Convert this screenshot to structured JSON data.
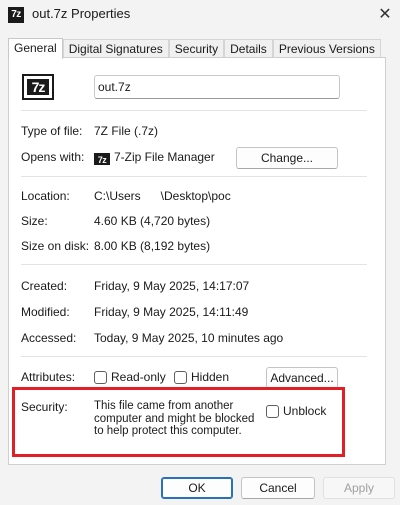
{
  "window": {
    "title": "out.7z Properties",
    "close_glyph": "✕",
    "icon_text": "7z"
  },
  "tabs": [
    {
      "label": "General"
    },
    {
      "label": "Digital Signatures"
    },
    {
      "label": "Security"
    },
    {
      "label": "Details"
    },
    {
      "label": "Previous Versions"
    }
  ],
  "general": {
    "icon_text": "7z",
    "file_name": "out.7z",
    "type_label": "Type of file:",
    "type_value": "7Z File (.7z)",
    "opens_label": "Opens with:",
    "opens_icon_text": "7z",
    "opens_value": "7-Zip File Manager",
    "change_button": "Change...",
    "location_label": "Location:",
    "location_value": "C:\\Users      \\Desktop\\poc",
    "size_label": "Size:",
    "size_value": "4.60 KB (4,720 bytes)",
    "size_disk_label": "Size on disk:",
    "size_disk_value": "8.00 KB (8,192 bytes)",
    "created_label": "Created:",
    "created_value": "Friday, 9 May 2025, 14:17:07",
    "modified_label": "Modified:",
    "modified_value": "Friday, 9 May 2025, 14:11:49",
    "accessed_label": "Accessed:",
    "accessed_value": "Today, 9 May 2025, 10 minutes ago",
    "attributes_label": "Attributes:",
    "readonly_label": "Read-only",
    "hidden_label": "Hidden",
    "advanced_button": "Advanced...",
    "security_label": "Security:",
    "security_text": "This file came from another computer and might be blocked to help protect this computer.",
    "unblock_label": "Unblock"
  },
  "footer": {
    "ok": "OK",
    "cancel": "Cancel",
    "apply": "Apply"
  },
  "colors": {
    "highlight_box": "#e21e26",
    "ok_border": "#2a6fba"
  }
}
